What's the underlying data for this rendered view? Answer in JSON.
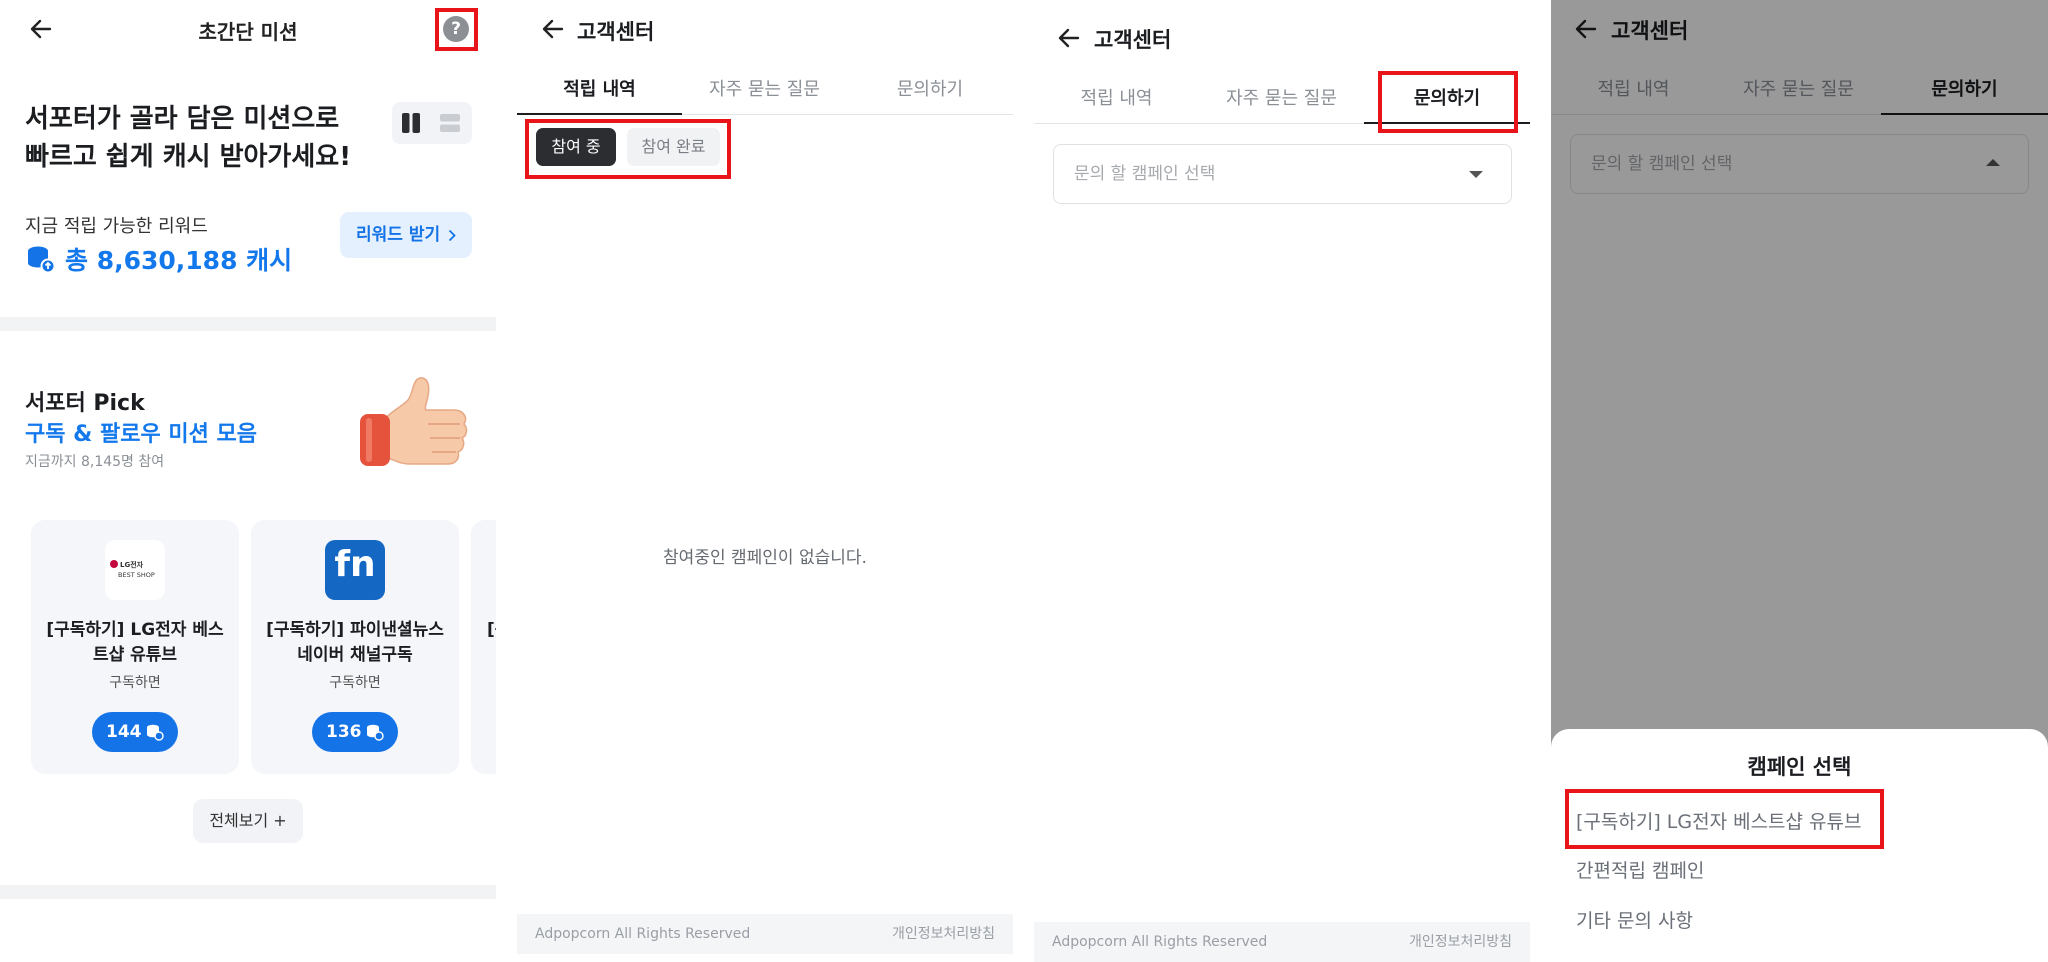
{
  "panel1": {
    "title": "초간단 미션",
    "help_icon_glyph": "?",
    "headline_line1": "서포터가 골라 담은 미션으로",
    "headline_line2": "빠르고 쉽게 캐시 받아가세요!",
    "reward_label": "지금 적립 가능한 리워드",
    "total_cash": "총 8,630,188 캐시",
    "reward_button": "리워드 받기",
    "pick_title": "서포터 Pick",
    "pick_subtitle": "구독 & 팔로우 미션 모음",
    "pick_count": "지금까지 8,145명 참여",
    "cards": [
      {
        "logo": "LG전자 BEST SHOP",
        "title_line1": "[구독하기] LG전자 베스",
        "title_line2": "트샵 유튜브",
        "sub": "구독하면",
        "reward": "144"
      },
      {
        "logo": "fn",
        "title_line1": "[구독하기] 파이낸셜뉴스",
        "title_line2": "네이버 채널구독",
        "sub": "구독하면",
        "reward": "136"
      },
      {
        "title_line1": "[구"
      }
    ],
    "view_all": "전체보기 +"
  },
  "panel2": {
    "title": "고객센터",
    "tabs": [
      "적립 내역",
      "자주 묻는 질문",
      "문의하기"
    ],
    "chip_active": "참여 중",
    "chip_inactive": "참여 완료",
    "empty_message": "참여중인 캠페인이 없습니다.",
    "footer_left": "Adpopcorn All Rights Reserved",
    "footer_right": "개인정보처리방침"
  },
  "panel3": {
    "title": "고객센터",
    "tabs": [
      "적립 내역",
      "자주 묻는 질문",
      "문의하기"
    ],
    "select_placeholder": "문의 할 캠페인 선택",
    "footer_left": "Adpopcorn All Rights Reserved",
    "footer_right": "개인정보처리방침"
  },
  "panel4": {
    "title": "고객센터",
    "tabs": [
      "적립 내역",
      "자주 묻는 질문",
      "문의하기"
    ],
    "select_placeholder": "문의 할 캠페인 선택",
    "sheet_title": "캠페인 선택",
    "options": [
      "[구독하기] LG전자 베스트샵 유튜브",
      "간편적립 캠페인",
      "기타 문의 사항"
    ]
  },
  "colors": {
    "accent": "#1473e6",
    "highlight": "#e8141a",
    "dark_chip": "#2b2d31"
  }
}
